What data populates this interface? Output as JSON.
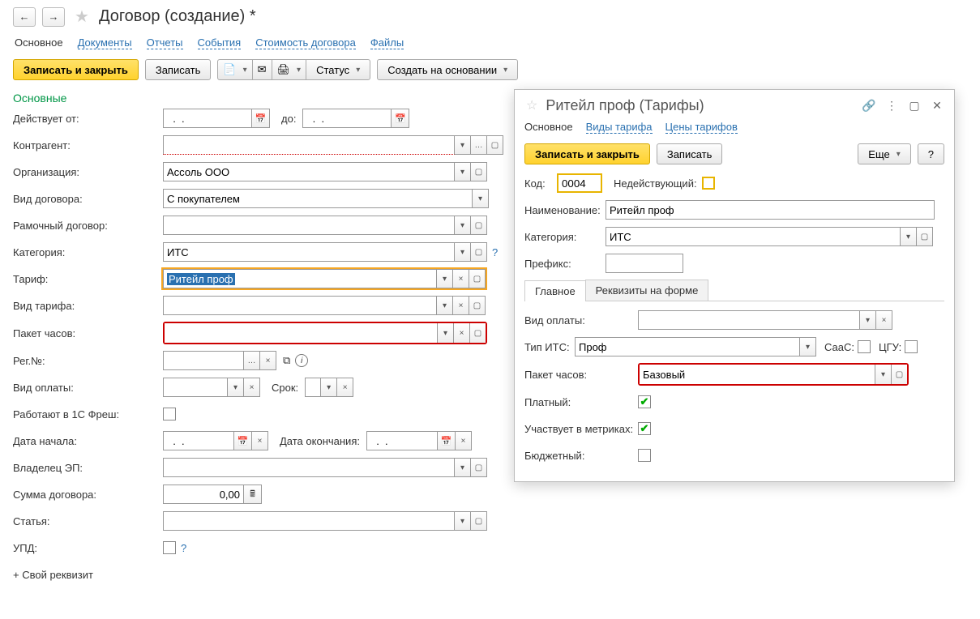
{
  "header": {
    "title": "Договор (создание) *"
  },
  "tabs": [
    "Основное",
    "Документы",
    "Отчеты",
    "События",
    "Стоимость договора",
    "Файлы"
  ],
  "toolbar": {
    "save_close": "Записать и закрыть",
    "save": "Записать",
    "status": "Статус",
    "create_based": "Создать на основании"
  },
  "section": "Основные",
  "form": {
    "effective_from": "Действует от:",
    "effective_from_val": "  .  .    ",
    "to": "до:",
    "to_val": "  .  .    ",
    "counterparty": "Контрагент:",
    "counterparty_val": "",
    "organization": "Организация:",
    "organization_val": "Ассоль ООО",
    "contract_type": "Вид договора:",
    "contract_type_val": "С покупателем",
    "framework": "Рамочный договор:",
    "category": "Категория:",
    "category_val": "ИТС",
    "tariff": "Тариф:",
    "tariff_val": "Ритейл проф",
    "tariff_type": "Вид тарифа:",
    "hours_package": "Пакет часов:",
    "reg_no": "Рег.№:",
    "payment_type": "Вид оплаты:",
    "term": "Срок:",
    "fresh": "Работают в 1С Фреш:",
    "start_date": "Дата начала:",
    "start_date_val": "  .  .    ",
    "end_date": "Дата окончания:",
    "end_date_val": "  .  .    ",
    "ep_owner": "Владелец ЭП:",
    "amount": "Сумма договора:",
    "amount_val": "0,00",
    "article": "Статья:",
    "upd": "УПД:",
    "add_req": "+ Свой реквизит"
  },
  "popup": {
    "title": "Ритейл проф (Тарифы)",
    "tabs": [
      "Основное",
      "Виды тарифа",
      "Цены тарифов"
    ],
    "save_close": "Записать и закрыть",
    "save": "Записать",
    "more": "Еще",
    "help": "?",
    "code_label": "Код:",
    "code_val": "0004",
    "inactive": "Недействующий:",
    "name_label": "Наименование:",
    "name_val": "Ритейл проф",
    "category_label": "Категория:",
    "category_val": "ИТС",
    "prefix_label": "Префикс:",
    "inner_tabs": [
      "Главное",
      "Реквизиты на форме"
    ],
    "payment_type": "Вид оплаты:",
    "its_type": "Тип ИТС:",
    "its_type_val": "Проф",
    "saas": "СааС:",
    "cgu": "ЦГУ:",
    "hours_pkg": "Пакет часов:",
    "hours_pkg_val": "Базовый",
    "paid": "Платный:",
    "metrics": "Участвует в метриках:",
    "budget": "Бюджетный:"
  }
}
